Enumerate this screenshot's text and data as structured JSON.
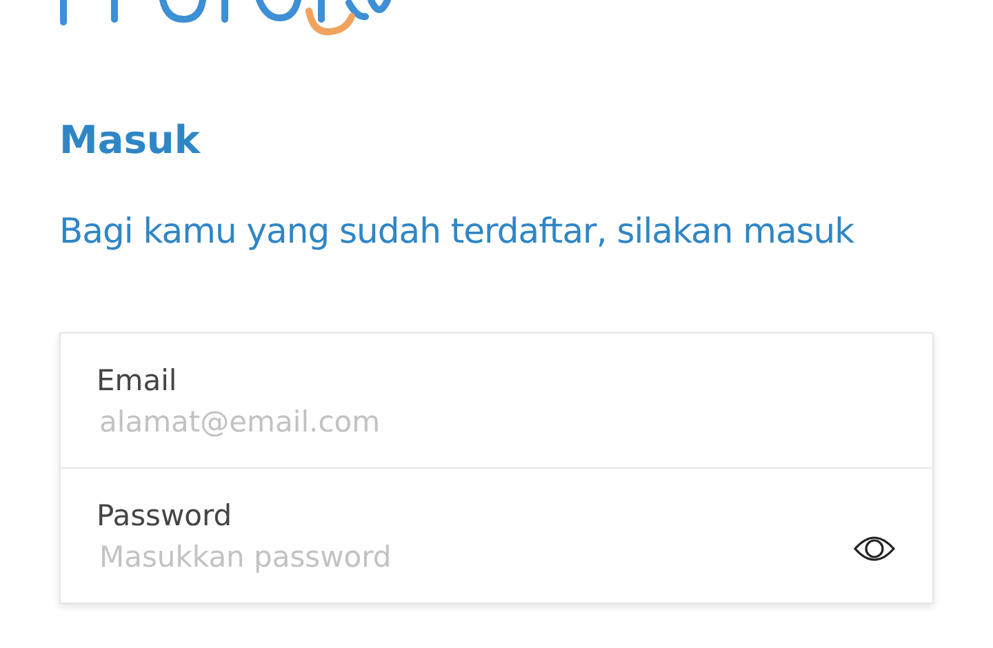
{
  "heading": "Masuk",
  "subtitle": "Bagi kamu yang sudah terdaftar, silakan masuk",
  "fields": [
    {
      "label": "Email",
      "placeholder": "alamat@email.com",
      "kind": "text"
    },
    {
      "label": "Password",
      "placeholder": "Masukkan password",
      "kind": "password"
    }
  ]
}
